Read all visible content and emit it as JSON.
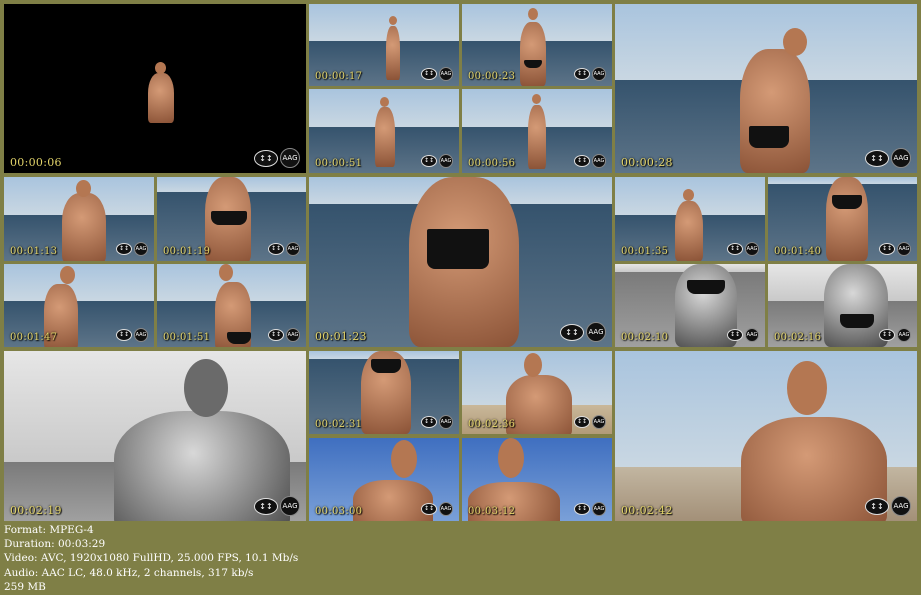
{
  "thumbnails": [
    {
      "timestamp": "00:00:06"
    },
    {
      "timestamp": "00:00:17"
    },
    {
      "timestamp": "00:00:23"
    },
    {
      "timestamp": "00:00:28"
    },
    {
      "timestamp": "00:00:51"
    },
    {
      "timestamp": "00:00:56"
    },
    {
      "timestamp": "00:01:13"
    },
    {
      "timestamp": "00:01:19"
    },
    {
      "timestamp": "00:01:23"
    },
    {
      "timestamp": "00:01:35"
    },
    {
      "timestamp": "00:01:40"
    },
    {
      "timestamp": "00:01:47"
    },
    {
      "timestamp": "00:01:51"
    },
    {
      "timestamp": "00:02:10"
    },
    {
      "timestamp": "00:02:16"
    },
    {
      "timestamp": "00:02:19"
    },
    {
      "timestamp": "00:02:31"
    },
    {
      "timestamp": "00:02:36"
    },
    {
      "timestamp": "00:02:42"
    },
    {
      "timestamp": "00:03:00"
    },
    {
      "timestamp": "00:03:12"
    }
  ],
  "watermark": {
    "badge": "↕↕",
    "logo": "AAG"
  },
  "info": {
    "format": "Format: MPEG-4",
    "duration": "Duration: 00:03:29",
    "video": "Video: AVC, 1920x1080 FullHD, 25.000 FPS, 10.1 Mb/s",
    "audio": "Audio: AAC LC, 48.0 kHz, 2 channels, 317 kb/s",
    "size": "259 MB"
  },
  "colors": {
    "background": "#7f7f46",
    "timestamp": "#e3d46a",
    "text": "#ffffff"
  }
}
